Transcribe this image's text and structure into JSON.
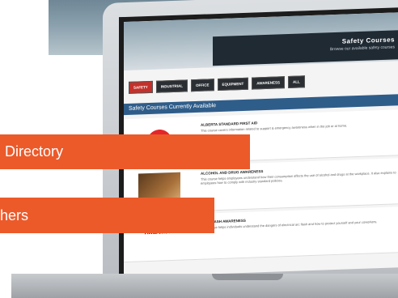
{
  "site": {
    "title": "Safety Courses",
    "subtitle": "Browse our available safety courses"
  },
  "nav": [
    "SAFETY",
    "INDUSTRIAL",
    "OFFICE",
    "EQUIPMENT",
    "AWARENESS",
    "ALL"
  ],
  "section_heading": "Safety Courses Currently Available",
  "courses": [
    {
      "title": "ALBERTA STANDARD FIRST AID",
      "desc": "This course covers information related to support & emergency awareness when in the job or at home."
    },
    {
      "title": "ALCOHOL AND DRUG AWARENESS",
      "desc": "This course helps employees understand how their consumption affects the use of alcohol and drugs at the workplace. It also explains to employees how to comply with industry standard policies."
    },
    {
      "title": "ARC FLASH AWARENESS",
      "desc": "This course helps individuals understand the dangers of electrical arc flash and how to protect yourself and your coworkers.",
      "thumb_text": "Arc Flash Awareness"
    }
  ],
  "ribbons": {
    "first": "Directory",
    "second": "hers"
  },
  "colors": {
    "ribbon": "#ec5a2a",
    "banner": "#1f2a33",
    "active_tab": "#c4302b"
  }
}
